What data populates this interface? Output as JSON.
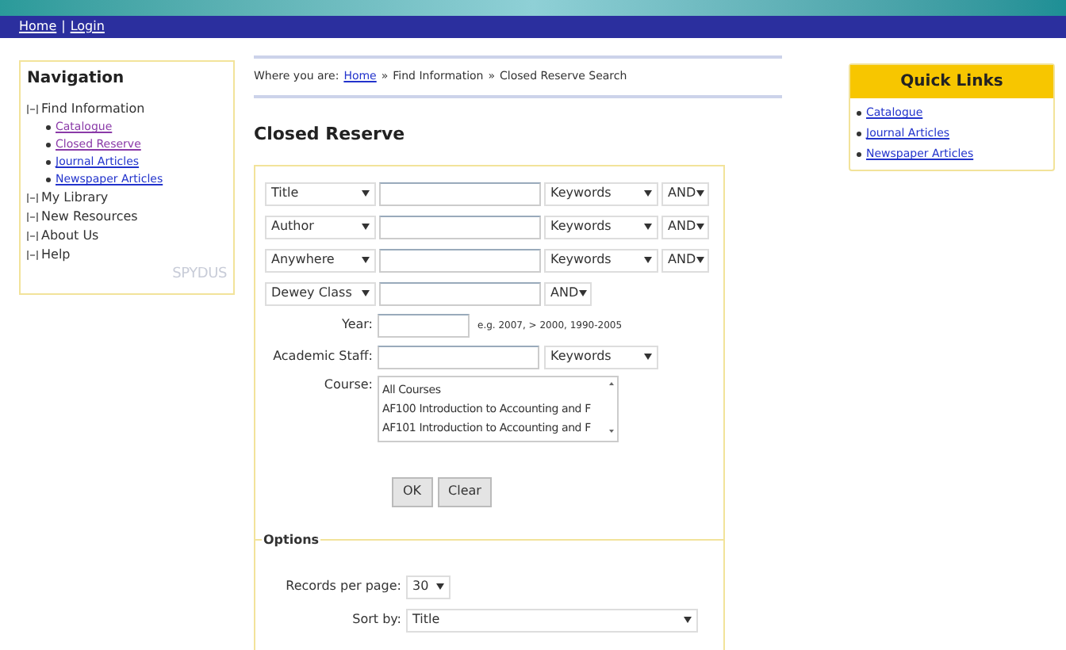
{
  "top_bar": {
    "links": [
      "Home",
      "Login"
    ],
    "separator": "|"
  },
  "navigation": {
    "title": "Navigation",
    "logo": "SPYDUS",
    "items": [
      {
        "label": "Find Information",
        "children": [
          {
            "label": "Catalogue",
            "visited": true
          },
          {
            "label": "Closed Reserve",
            "visited": true
          },
          {
            "label": "Journal Articles",
            "visited": false
          },
          {
            "label": "Newspaper Articles",
            "visited": false
          }
        ]
      },
      {
        "label": "My Library"
      },
      {
        "label": "New Resources"
      },
      {
        "label": "About Us"
      },
      {
        "label": "Help"
      }
    ]
  },
  "breadcrumb": {
    "prefix": "Where you are:",
    "parts": [
      {
        "label": "Home",
        "link": true
      },
      {
        "label": "Find Information",
        "link": false
      },
      {
        "label": "Closed Reserve Search",
        "link": false
      }
    ],
    "separator": "»"
  },
  "page_title": "Closed Reserve",
  "search_rows": [
    {
      "field": "Title",
      "operator": "Keywords",
      "conjunction": "AND"
    },
    {
      "field": "Author",
      "operator": "Keywords",
      "conjunction": "AND"
    },
    {
      "field": "Anywhere",
      "operator": "Keywords",
      "conjunction": "AND"
    },
    {
      "field": "Dewey Class",
      "conjunction": "AND"
    }
  ],
  "year": {
    "label": "Year:",
    "hint": "e.g. 2007, > 2000, 1990-2005"
  },
  "academic_staff": {
    "label": "Academic Staff:",
    "operator": "Keywords"
  },
  "course": {
    "label": "Course:",
    "options": [
      "All Courses",
      "AF100 Introduction to Accounting and F",
      "AF101 Introduction to Accounting and F"
    ]
  },
  "buttons": [
    "OK",
    "Clear"
  ],
  "options": {
    "legend": "Options",
    "records_label": "Records per page:",
    "records_value": "30",
    "sort_label": "Sort by:",
    "sort_value": "Title"
  },
  "quick_links": {
    "title": "Quick Links",
    "links": [
      "Catalogue",
      "Journal Articles",
      "Newspaper Articles"
    ]
  }
}
